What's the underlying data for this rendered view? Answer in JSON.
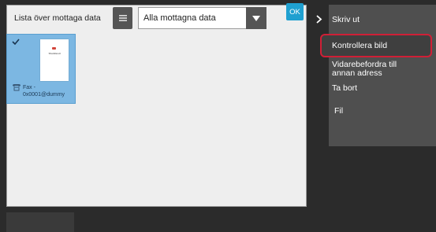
{
  "toolbar": {
    "list_label": "Lista över mottaga data",
    "filter_value": "Alla mottagna data",
    "ok_label": "OK"
  },
  "thumbnail": {
    "page_text": "Thumbnail",
    "fax_line1": "Fax -",
    "fax_line2": "0x0001@dummy"
  },
  "menu": {
    "items": [
      {
        "label": "Skriv ut"
      },
      {
        "label": "Kontrollera bild"
      },
      {
        "label_line1": "Vidarebefordra till",
        "label_line2": "annan adress"
      },
      {
        "label": "Ta bort"
      },
      {
        "label": "Fil"
      }
    ]
  },
  "colors": {
    "accent_ok": "#1fa0d0",
    "selection": "#7cb7e2",
    "highlight_border": "#d01f36"
  },
  "icons": [
    "list-view-icon",
    "dropdown-arrow-icon",
    "check-icon",
    "fax-icon",
    "chevron-right-icon"
  ]
}
